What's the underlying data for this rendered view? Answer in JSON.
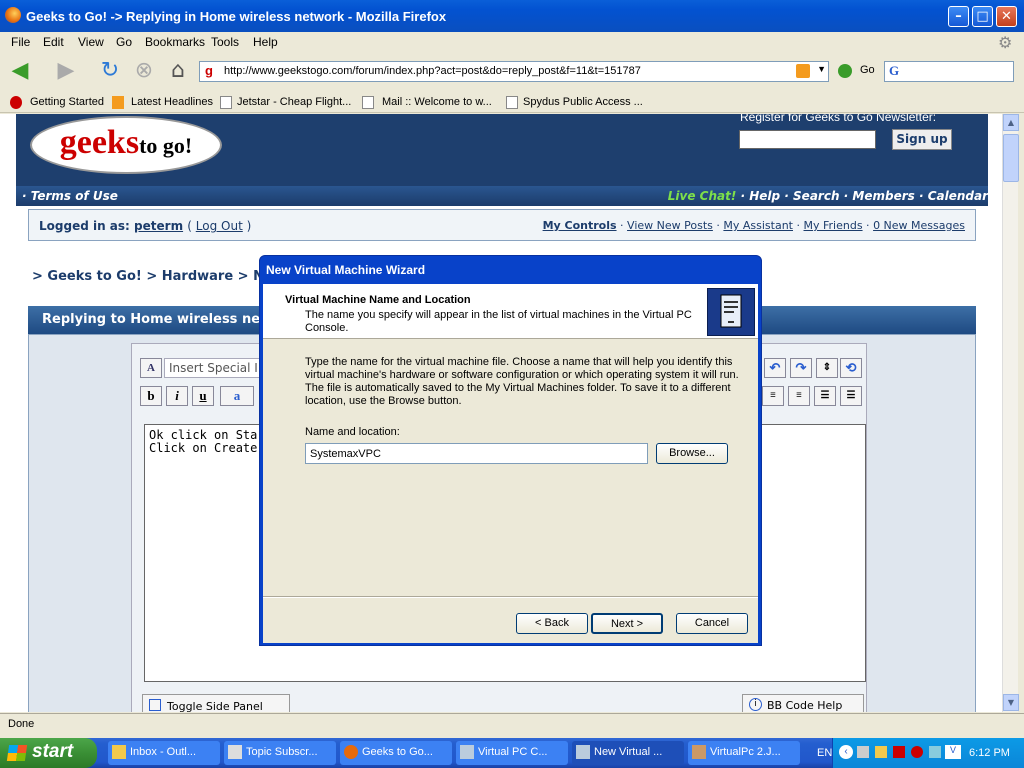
{
  "window": {
    "title": "Geeks to Go! -> Replying in Home wireless network - Mozilla Firefox"
  },
  "menu": [
    "File",
    "Edit",
    "View",
    "Go",
    "Bookmarks",
    "Tools",
    "Help"
  ],
  "nav": {
    "url": "http://www.geekstogo.com/forum/index.php?act=post&do=reply_post&f=11&t=151787",
    "go_label": "Go"
  },
  "bookmarks": [
    "Getting Started",
    "Latest Headlines",
    "Jetstar - Cheap Flight...",
    "Mail :: Welcome to w...",
    "Spydus Public Access ..."
  ],
  "site": {
    "logo_main": "geeks",
    "logo_sub": "to go!",
    "newsletter_label": "Register for Geeks to Go Newsletter:",
    "signup": "Sign up",
    "terms": "· Terms of Use",
    "livechat": "Live Chat!",
    "toplinks": " · Help · Search · Members · Calendar",
    "logged_in_as": "Logged in as:",
    "username": "peterm",
    "logout": "Log Out",
    "my_controls": "My Controls",
    "view_new_posts": "View New Posts",
    "my_assistant": "My Assistant",
    "my_friends": "My Friends",
    "new_messages": "0 New Messages",
    "breadcrumb": "> Geeks to Go! > Hardware > Netw",
    "reply_header": "Replying to Home wireless netwo",
    "special_char": "Insert Special I",
    "text_line1": "Ok click on Start >a",
    "text_line2": "Click on Create a v",
    "toggle_panel": "Toggle Side Panel",
    "bbcode_help": "BB Code Help"
  },
  "status": "Done",
  "dialog": {
    "title": "New Virtual Machine Wizard",
    "heading": "Virtual Machine Name and Location",
    "subheading": "The name you specify will appear in the list of virtual machines in the Virtual PC Console.",
    "description": "Type the name for the virtual machine file. Choose a name that will help you identify this virtual machine's hardware or software configuration or which operating system it will run. The file is automatically saved to the My Virtual Machines folder. To save it to a different location, use the Browse button.",
    "field_label": "Name and location:",
    "field_value": "SystemaxVPC",
    "browse": "Browse...",
    "back": "< Back",
    "next": "Next >",
    "cancel": "Cancel"
  },
  "taskbar": {
    "start": "start",
    "tasks": [
      "Inbox - Outl...",
      "Topic Subscr...",
      "Geeks to Go...",
      "Virtual PC C...",
      "New Virtual ...",
      "VirtualPc 2.J..."
    ],
    "lang": "EN",
    "clock": "6:12 PM"
  }
}
